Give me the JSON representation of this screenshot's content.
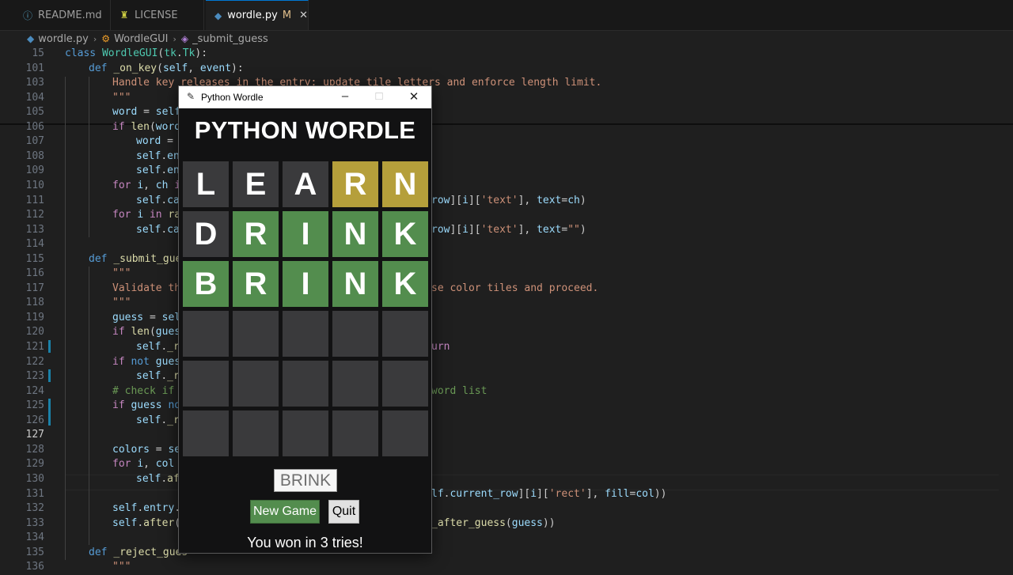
{
  "tabs": [
    {
      "label": "README.md",
      "icon": "info-icon",
      "modified": ""
    },
    {
      "label": "LICENSE",
      "icon": "license-icon",
      "modified": ""
    },
    {
      "label": "wordle.py",
      "icon": "python-file-icon",
      "modified": "M"
    }
  ],
  "breadcrumb": [
    "wordle.py",
    "WordleGUI",
    "_submit_guess"
  ],
  "editor": {
    "lines": [
      {
        "n": "15",
        "indent": 0,
        "code": [
          [
            "kw",
            "class "
          ],
          [
            "cls",
            "WordleGUI"
          ],
          [
            "pl",
            "("
          ],
          [
            "cls",
            "tk"
          ],
          [
            "pl",
            "."
          ],
          [
            "cls",
            "Tk"
          ],
          [
            "pl",
            "):"
          ]
        ]
      },
      {
        "n": "101",
        "indent": 1,
        "code": [
          [
            "kw",
            "def "
          ],
          [
            "fn",
            "_on_key"
          ],
          [
            "pl",
            "("
          ],
          [
            "self",
            "self"
          ],
          [
            "pl",
            ", "
          ],
          [
            "self",
            "event"
          ],
          [
            "pl",
            "):"
          ]
        ]
      },
      {
        "n": "103",
        "indent": 2,
        "code": [
          [
            "str",
            "Handle key releases in the entry; update tile letters and enforce length limit."
          ]
        ]
      },
      {
        "n": "104",
        "indent": 2,
        "code": [
          [
            "str",
            "\"\"\""
          ]
        ]
      },
      {
        "n": "105",
        "indent": 2,
        "code": [
          [
            "self",
            "word "
          ],
          [
            "pl",
            "= "
          ],
          [
            "self",
            "self"
          ]
        ]
      },
      {
        "n": "106",
        "indent": 2,
        "code": [
          [
            "ctl",
            "if "
          ],
          [
            "fn",
            "len"
          ],
          [
            "pl",
            "("
          ],
          [
            "self",
            "word"
          ],
          [
            "pl",
            ")"
          ]
        ]
      },
      {
        "n": "107",
        "indent": 3,
        "code": [
          [
            "self",
            "word "
          ],
          [
            "pl",
            "= w"
          ]
        ]
      },
      {
        "n": "108",
        "indent": 3,
        "code": [
          [
            "self",
            "self"
          ],
          [
            "pl",
            "."
          ],
          [
            "self",
            "ent"
          ]
        ]
      },
      {
        "n": "109",
        "indent": 3,
        "code": [
          [
            "self",
            "self"
          ],
          [
            "pl",
            "."
          ],
          [
            "self",
            "ent"
          ]
        ]
      },
      {
        "n": "110",
        "indent": 2,
        "code": [
          [
            "ctl",
            "for "
          ],
          [
            "self",
            "i"
          ],
          [
            "pl",
            ", "
          ],
          [
            "self",
            "ch "
          ],
          [
            "ctl",
            "in"
          ]
        ]
      },
      {
        "n": "111",
        "indent": 3,
        "code": [
          [
            "self",
            "self"
          ],
          [
            "pl",
            "."
          ],
          [
            "self",
            "can"
          ]
        ],
        "tail": [
          [
            "self",
            "row"
          ],
          [
            "pl",
            "]["
          ],
          [
            "self",
            "i"
          ],
          [
            "pl",
            "]["
          ],
          [
            "str",
            "'text'"
          ],
          [
            "pl",
            "], "
          ],
          [
            "self",
            "text"
          ],
          [
            "pl",
            "="
          ],
          [
            "self",
            "ch"
          ],
          [
            "pl",
            ")"
          ]
        ]
      },
      {
        "n": "112",
        "indent": 2,
        "code": [
          [
            "ctl",
            "for "
          ],
          [
            "self",
            "i "
          ],
          [
            "ctl",
            "in "
          ],
          [
            "fn",
            "ran"
          ]
        ]
      },
      {
        "n": "113",
        "indent": 3,
        "code": [
          [
            "self",
            "self"
          ],
          [
            "pl",
            "."
          ],
          [
            "self",
            "can"
          ]
        ],
        "tail": [
          [
            "self",
            "row"
          ],
          [
            "pl",
            "]["
          ],
          [
            "self",
            "i"
          ],
          [
            "pl",
            "]["
          ],
          [
            "str",
            "'text'"
          ],
          [
            "pl",
            "], "
          ],
          [
            "self",
            "text"
          ],
          [
            "pl",
            "="
          ],
          [
            "str",
            "\"\""
          ],
          [
            "pl",
            ")"
          ]
        ]
      },
      {
        "n": "114",
        "indent": 0,
        "code": []
      },
      {
        "n": "115",
        "indent": 1,
        "code": [
          [
            "kw",
            "def "
          ],
          [
            "fn",
            "_submit_gues"
          ]
        ]
      },
      {
        "n": "116",
        "indent": 2,
        "code": [
          [
            "str",
            "\"\"\""
          ]
        ]
      },
      {
        "n": "117",
        "indent": 2,
        "code": [
          [
            "str",
            "Validate the"
          ]
        ],
        "tail": [
          [
            "str",
            "se color tiles and proceed."
          ]
        ]
      },
      {
        "n": "118",
        "indent": 2,
        "code": [
          [
            "str",
            "\"\"\""
          ]
        ]
      },
      {
        "n": "119",
        "indent": 2,
        "code": [
          [
            "self",
            "guess "
          ],
          [
            "pl",
            "= "
          ],
          [
            "self",
            "self"
          ]
        ]
      },
      {
        "n": "120",
        "indent": 2,
        "code": [
          [
            "ctl",
            "if "
          ],
          [
            "fn",
            "len"
          ],
          [
            "pl",
            "("
          ],
          [
            "self",
            "gues"
          ]
        ]
      },
      {
        "n": "121",
        "indent": 3,
        "code": [
          [
            "self",
            "self"
          ],
          [
            "pl",
            "."
          ],
          [
            "fn",
            "_re"
          ]
        ],
        "tail": [
          [
            "ctl",
            "urn"
          ]
        ]
      },
      {
        "n": "122",
        "indent": 2,
        "code": [
          [
            "ctl",
            "if "
          ],
          [
            "kw",
            "not "
          ],
          [
            "self",
            "guess"
          ]
        ]
      },
      {
        "n": "123",
        "indent": 3,
        "code": [
          [
            "self",
            "self"
          ],
          [
            "pl",
            "."
          ],
          [
            "fn",
            "_re"
          ]
        ]
      },
      {
        "n": "124",
        "indent": 2,
        "code": [
          [
            "cmt",
            "# check if "
          ]
        ],
        "tail": [
          [
            "cmt",
            "word list"
          ]
        ]
      },
      {
        "n": "125",
        "indent": 2,
        "code": [
          [
            "ctl",
            "if "
          ],
          [
            "self",
            "guess "
          ],
          [
            "kw",
            "not"
          ]
        ]
      },
      {
        "n": "126",
        "indent": 3,
        "code": [
          [
            "self",
            "self"
          ],
          [
            "pl",
            "."
          ],
          [
            "fn",
            "_re"
          ]
        ]
      },
      {
        "n": "127",
        "indent": 0,
        "code": [],
        "current": true
      },
      {
        "n": "128",
        "indent": 2,
        "code": [
          [
            "self",
            "colors "
          ],
          [
            "pl",
            "= "
          ],
          [
            "self",
            "sel"
          ]
        ]
      },
      {
        "n": "129",
        "indent": 2,
        "code": [
          [
            "ctl",
            "for "
          ],
          [
            "self",
            "i"
          ],
          [
            "pl",
            ", "
          ],
          [
            "self",
            "col "
          ]
        ]
      },
      {
        "n": "130",
        "indent": 3,
        "code": [
          [
            "self",
            "self"
          ],
          [
            "pl",
            "."
          ],
          [
            "fn",
            "aft"
          ]
        ]
      },
      {
        "n": "131",
        "indent": 4,
        "code": [],
        "tail": [
          [
            "self",
            "lf"
          ],
          [
            "pl",
            "."
          ],
          [
            "self",
            "current_row"
          ],
          [
            "pl",
            "]["
          ],
          [
            "self",
            "i"
          ],
          [
            "pl",
            "]["
          ],
          [
            "str",
            "'rect'"
          ],
          [
            "pl",
            "], "
          ],
          [
            "self",
            "fill"
          ],
          [
            "pl",
            "="
          ],
          [
            "self",
            "col"
          ],
          [
            "pl",
            "))"
          ]
        ]
      },
      {
        "n": "132",
        "indent": 2,
        "code": [
          [
            "self",
            "self"
          ],
          [
            "pl",
            "."
          ],
          [
            "self",
            "entry"
          ],
          [
            "pl",
            "."
          ]
        ]
      },
      {
        "n": "133",
        "indent": 2,
        "code": [
          [
            "self",
            "self"
          ],
          [
            "pl",
            "."
          ],
          [
            "fn",
            "after"
          ],
          [
            "pl",
            "(1"
          ]
        ],
        "tail": [
          [
            "fn",
            "_after_guess"
          ],
          [
            "pl",
            "("
          ],
          [
            "self",
            "guess"
          ],
          [
            "pl",
            "))"
          ]
        ]
      },
      {
        "n": "134",
        "indent": 0,
        "code": []
      },
      {
        "n": "135",
        "indent": 1,
        "code": [
          [
            "kw",
            "def "
          ],
          [
            "fn",
            "_reject_gues"
          ]
        ]
      },
      {
        "n": "136",
        "indent": 2,
        "code": [
          [
            "str",
            "\"\"\""
          ]
        ]
      }
    ]
  },
  "app": {
    "window_title": "Python Wordle",
    "heading": "PYTHON WORDLE",
    "board": [
      [
        {
          "l": "L",
          "s": "absent"
        },
        {
          "l": "E",
          "s": "absent"
        },
        {
          "l": "A",
          "s": "absent"
        },
        {
          "l": "R",
          "s": "present"
        },
        {
          "l": "N",
          "s": "present"
        }
      ],
      [
        {
          "l": "D",
          "s": "absent"
        },
        {
          "l": "R",
          "s": "correct"
        },
        {
          "l": "I",
          "s": "correct"
        },
        {
          "l": "N",
          "s": "correct"
        },
        {
          "l": "K",
          "s": "correct"
        }
      ],
      [
        {
          "l": "B",
          "s": "correct"
        },
        {
          "l": "R",
          "s": "correct"
        },
        {
          "l": "I",
          "s": "correct"
        },
        {
          "l": "N",
          "s": "correct"
        },
        {
          "l": "K",
          "s": "correct"
        }
      ],
      [
        {
          "l": "",
          "s": "empty"
        },
        {
          "l": "",
          "s": "empty"
        },
        {
          "l": "",
          "s": "empty"
        },
        {
          "l": "",
          "s": "empty"
        },
        {
          "l": "",
          "s": "empty"
        }
      ],
      [
        {
          "l": "",
          "s": "empty"
        },
        {
          "l": "",
          "s": "empty"
        },
        {
          "l": "",
          "s": "empty"
        },
        {
          "l": "",
          "s": "empty"
        },
        {
          "l": "",
          "s": "empty"
        }
      ],
      [
        {
          "l": "",
          "s": "empty"
        },
        {
          "l": "",
          "s": "empty"
        },
        {
          "l": "",
          "s": "empty"
        },
        {
          "l": "",
          "s": "empty"
        },
        {
          "l": "",
          "s": "empty"
        }
      ]
    ],
    "entry_value": "BRINK",
    "new_game_label": "New Game",
    "quit_label": "Quit",
    "status": "You won in 3 tries!",
    "colors": {
      "correct": "#538d4e",
      "present": "#b59f3b",
      "absent": "#3a3a3c",
      "empty": "#3a3a3c"
    }
  }
}
